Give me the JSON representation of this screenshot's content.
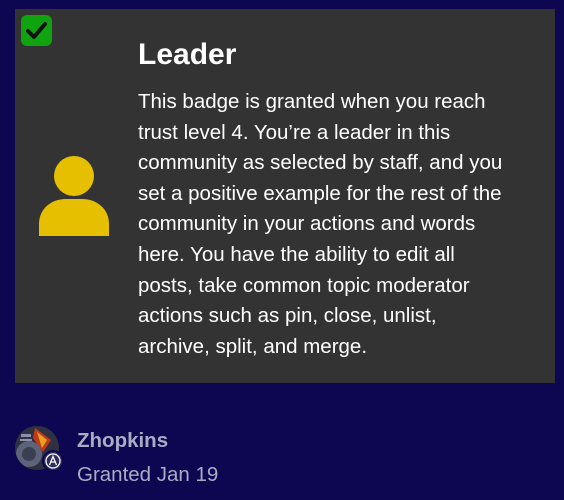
{
  "badge": {
    "title": "Leader",
    "granted_indicator_icon": "checkmark-icon",
    "icon": "user-icon",
    "icon_color": "#e6c000",
    "description_lines": [
      "This badge is granted when you reach",
      "trust level 4. You’re a leader in this",
      "community as selected by staff, and you",
      "set a positive example for the rest of the",
      "community in your actions and words",
      "here. You have the ability to edit all",
      "posts, take common topic moderator",
      "actions such as pin, close, unlist,",
      "archive, split, and merge."
    ]
  },
  "grant": {
    "username": "Zhopkins",
    "granted_text": "Granted Jan 19",
    "avatar_flair_icon": "moderator-flair-icon"
  },
  "colors": {
    "page_background": "#0d0650",
    "card_background": "#333333",
    "check_green": "#10a310",
    "text_primary": "#ffffff",
    "text_muted": "#a8acc4"
  }
}
